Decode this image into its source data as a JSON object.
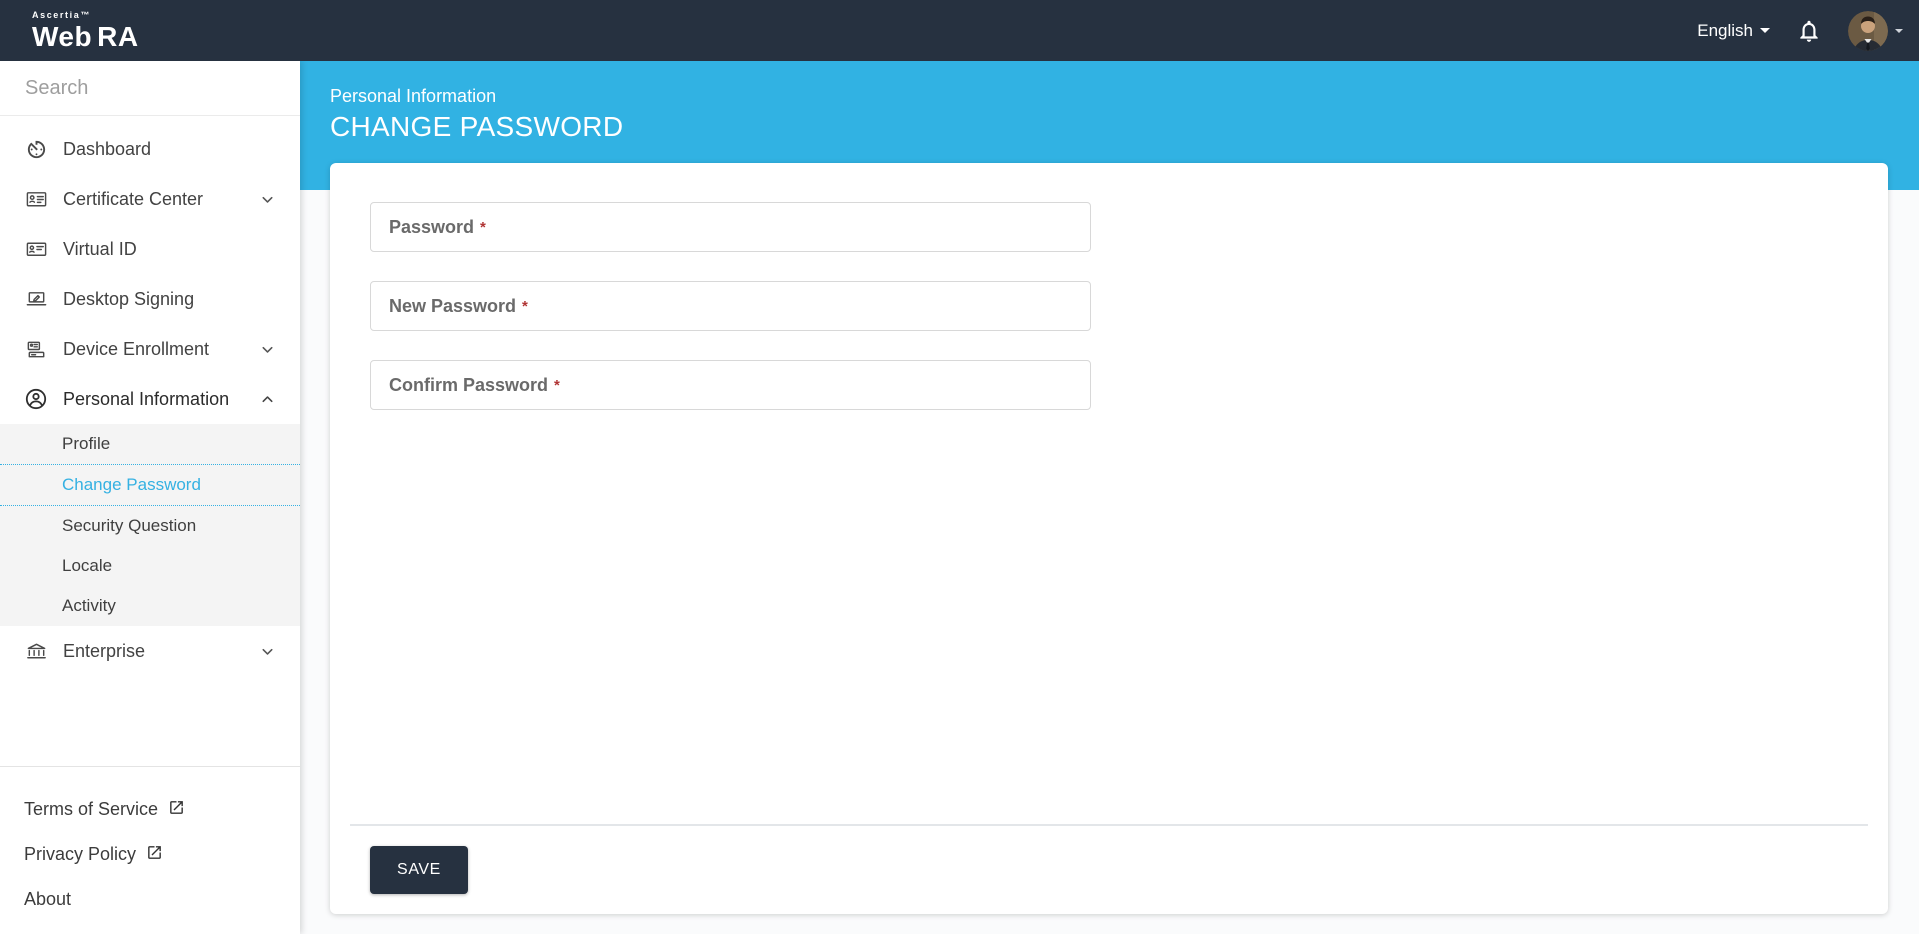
{
  "colors": {
    "navbar_bg": "#263140",
    "accent_blue": "#31B2E3",
    "active_link_blue": "#35B1E2",
    "save_button_bg": "#263140",
    "required_asterisk_red": "#B03434",
    "submenu_bg": "#F4F4F4"
  },
  "navbar": {
    "brand_top": "Ascertia™",
    "brand": {
      "prefix": "Web",
      "suffix": "RA"
    },
    "language": "English",
    "icons": [
      "caret-down-icon",
      "bell-icon",
      "avatar",
      "caret-down-icon"
    ]
  },
  "sidebar": {
    "search_placeholder": "Search",
    "items": [
      {
        "label": "Dashboard",
        "icon": "dashboard-gauge-icon",
        "expandable": false
      },
      {
        "label": "Certificate Center",
        "icon": "certificate-icon",
        "expandable": true,
        "expanded": false
      },
      {
        "label": "Virtual ID",
        "icon": "id-card-icon",
        "expandable": false
      },
      {
        "label": "Desktop Signing",
        "icon": "desktop-signing-icon",
        "expandable": false
      },
      {
        "label": "Device Enrollment",
        "icon": "device-enrollment-icon",
        "expandable": true,
        "expanded": false
      },
      {
        "label": "Personal Information",
        "icon": "person-circle-icon",
        "expandable": true,
        "expanded": true
      }
    ],
    "personal_information_submenu": [
      {
        "label": "Profile",
        "active": false
      },
      {
        "label": "Change Password",
        "active": true
      },
      {
        "label": "Security Question",
        "active": false
      },
      {
        "label": "Locale",
        "active": false
      },
      {
        "label": "Activity",
        "active": false
      }
    ],
    "items_after": [
      {
        "label": "Enterprise",
        "icon": "bank-icon",
        "expandable": true,
        "expanded": false
      }
    ],
    "footer_links": [
      {
        "label": "Terms of Service",
        "external": true
      },
      {
        "label": "Privacy Policy",
        "external": true
      },
      {
        "label": "About",
        "external": false
      }
    ]
  },
  "main": {
    "breadcrumb": "Personal Information",
    "title": "CHANGE PASSWORD",
    "form": {
      "required_marker": "*",
      "fields": [
        {
          "label": "Password",
          "required": true,
          "value": ""
        },
        {
          "label": "New Password",
          "required": true,
          "value": ""
        },
        {
          "label": "Confirm Password",
          "required": true,
          "value": ""
        }
      ],
      "save_label": "SAVE"
    }
  }
}
